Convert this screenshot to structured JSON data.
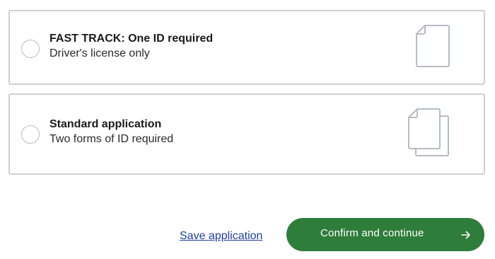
{
  "options": [
    {
      "title": "FAST TRACK: One ID required",
      "subtitle": "Driver's license only",
      "icon": "single-document-icon",
      "selected": false
    },
    {
      "title": "Standard application",
      "subtitle": "Two forms of ID required",
      "icon": "two-documents-icon",
      "selected": false
    }
  ],
  "actions": {
    "save_label": "Save application",
    "confirm_label": "Confirm and continue",
    "confirm_icon": "arrow-right-icon"
  },
  "colors": {
    "primary_button": "#2f7d3a",
    "link": "#1f3f9e",
    "card_border": "#cfcfcf",
    "icon_stroke": "#b6bcc4"
  }
}
